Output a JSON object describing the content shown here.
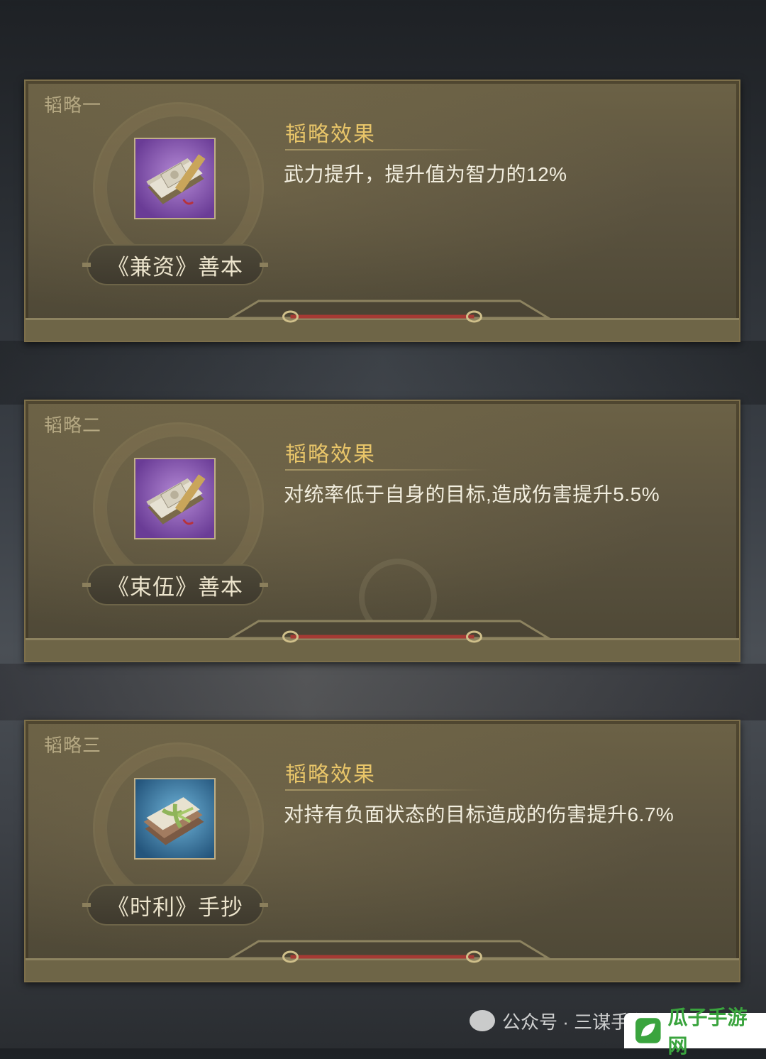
{
  "cards": [
    {
      "title": "韬略一",
      "item_name": "《兼资》善本",
      "icon": "book-scroll-icon",
      "icon_bg": "#8a5cb4",
      "effect_title": "韬略效果",
      "effect_desc": "武力提升，提升值为智力的12%"
    },
    {
      "title": "韬略二",
      "item_name": "《束伍》善本",
      "icon": "book-scroll-icon",
      "icon_bg": "#8a5cb4",
      "effect_title": "韬略效果",
      "effect_desc": "对统率低于自身的目标,造成伤害提升5.5%"
    },
    {
      "title": "韬略三",
      "item_name": "《时利》手抄",
      "icon": "bound-manuscript-icon",
      "icon_bg": "#3f86b0",
      "effect_title": "韬略效果",
      "effect_desc": "对持有负面状态的目标造成的伤害提升6.7%"
    }
  ],
  "watermark": {
    "text": "公众号 · 三谋手游攻略社"
  },
  "site_badge": {
    "text": "瓜子手游网"
  },
  "colors": {
    "accent_gold": "#e8c569",
    "card_bg": "#5c5440"
  }
}
